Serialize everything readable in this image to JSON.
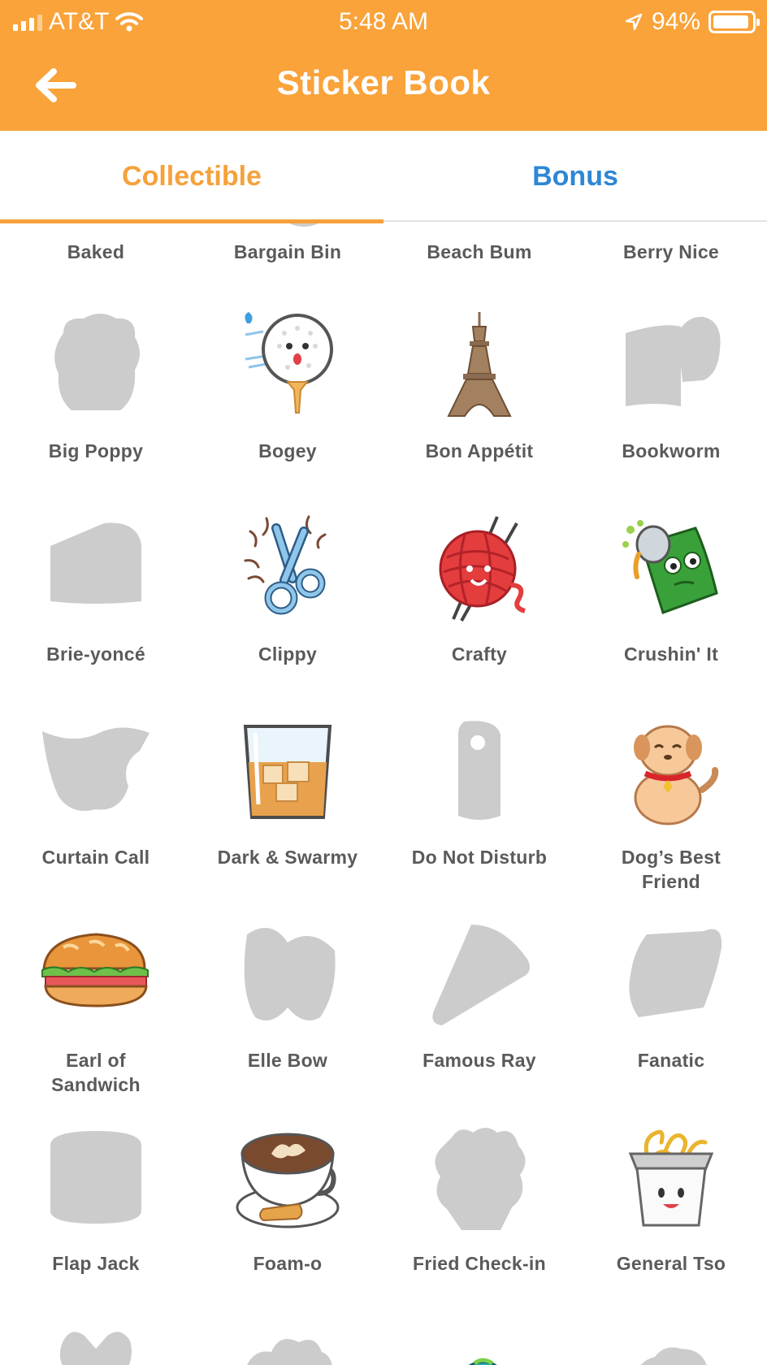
{
  "status_bar": {
    "carrier": "AT&T",
    "time": "5:48 AM",
    "battery": "94%"
  },
  "header": {
    "title": "Sticker Book"
  },
  "tabs": [
    {
      "label": "Collectible",
      "active": true
    },
    {
      "label": "Bonus",
      "active": false
    }
  ],
  "stickers": [
    {
      "name": "Baked",
      "collected": false
    },
    {
      "name": "Bargain Bin",
      "collected": false
    },
    {
      "name": "Beach Bum",
      "collected": false
    },
    {
      "name": "Berry Nice",
      "collected": false
    },
    {
      "name": "Big Poppy",
      "collected": false
    },
    {
      "name": "Bogey",
      "collected": true
    },
    {
      "name": "Bon Appétit",
      "collected": true
    },
    {
      "name": "Bookworm",
      "collected": false
    },
    {
      "name": "Brie-yoncé",
      "collected": false
    },
    {
      "name": "Clippy",
      "collected": true
    },
    {
      "name": "Crafty",
      "collected": true
    },
    {
      "name": "Crushin' It",
      "collected": true
    },
    {
      "name": "Curtain Call",
      "collected": false
    },
    {
      "name": "Dark & Swarmy",
      "collected": true
    },
    {
      "name": "Do Not Disturb",
      "collected": false
    },
    {
      "name": "Dog’s Best\nFriend",
      "collected": true
    },
    {
      "name": "Earl of\nSandwich",
      "collected": true
    },
    {
      "name": "Elle Bow",
      "collected": false
    },
    {
      "name": "Famous Ray",
      "collected": false
    },
    {
      "name": "Fanatic",
      "collected": false
    },
    {
      "name": "Flap Jack",
      "collected": false
    },
    {
      "name": "Foam-o",
      "collected": true
    },
    {
      "name": "Fried Check-in",
      "collected": false
    },
    {
      "name": "General Tso",
      "collected": true
    }
  ],
  "colors": {
    "header": "#F9A33A",
    "active_tab": "#F5A13C",
    "inactive_tab": "#2E87D6",
    "silhouette": "#cccccc"
  },
  "icons": {
    "back": "arrow-left-icon",
    "wifi": "wifi-icon",
    "location": "location-arrow-icon",
    "battery": "battery-icon"
  }
}
